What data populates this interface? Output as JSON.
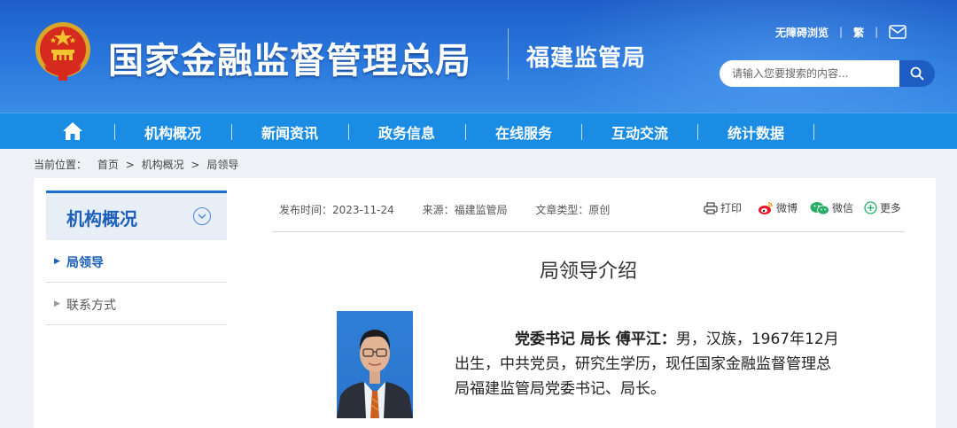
{
  "header": {
    "site_title": "国家金融监督管理总局",
    "sub_title": "福建监管局",
    "links": {
      "accessible": "无障碍浏览",
      "traditional": "繁"
    },
    "search_placeholder": "请输入您要搜索的内容..."
  },
  "nav": {
    "items": [
      "机构概况",
      "新闻资讯",
      "政务信息",
      "在线服务",
      "互动交流",
      "统计数据"
    ]
  },
  "breadcrumb": {
    "prefix": "当前位置：",
    "items": [
      "首页",
      "机构概况",
      "局领导"
    ],
    "separator": ">"
  },
  "sidebar": {
    "title": "机构概况",
    "items": [
      {
        "label": "局领导",
        "active": true
      },
      {
        "label": "联系方式",
        "active": false
      }
    ]
  },
  "article": {
    "meta": {
      "date": "发布时间：2023-11-24",
      "source": "来源：福建监管局",
      "type": "文章类型：原创"
    },
    "share": {
      "print": "打印",
      "weibo": "微博",
      "wechat": "微信",
      "more": "更多"
    },
    "title": "局领导介绍",
    "bio_name": "党委书记 局长 傅平江：",
    "bio_text": "男，汉族，1967年12月出生，中共党员，研究生学历，现任国家金融监督管理总局福建监管局党委书记、局长。"
  },
  "colors": {
    "header_top": "#1f5fc9",
    "nav_bg": "#1a8ce3",
    "accent": "#1b5fbb",
    "portrait_bg": "#2f7fd6"
  }
}
